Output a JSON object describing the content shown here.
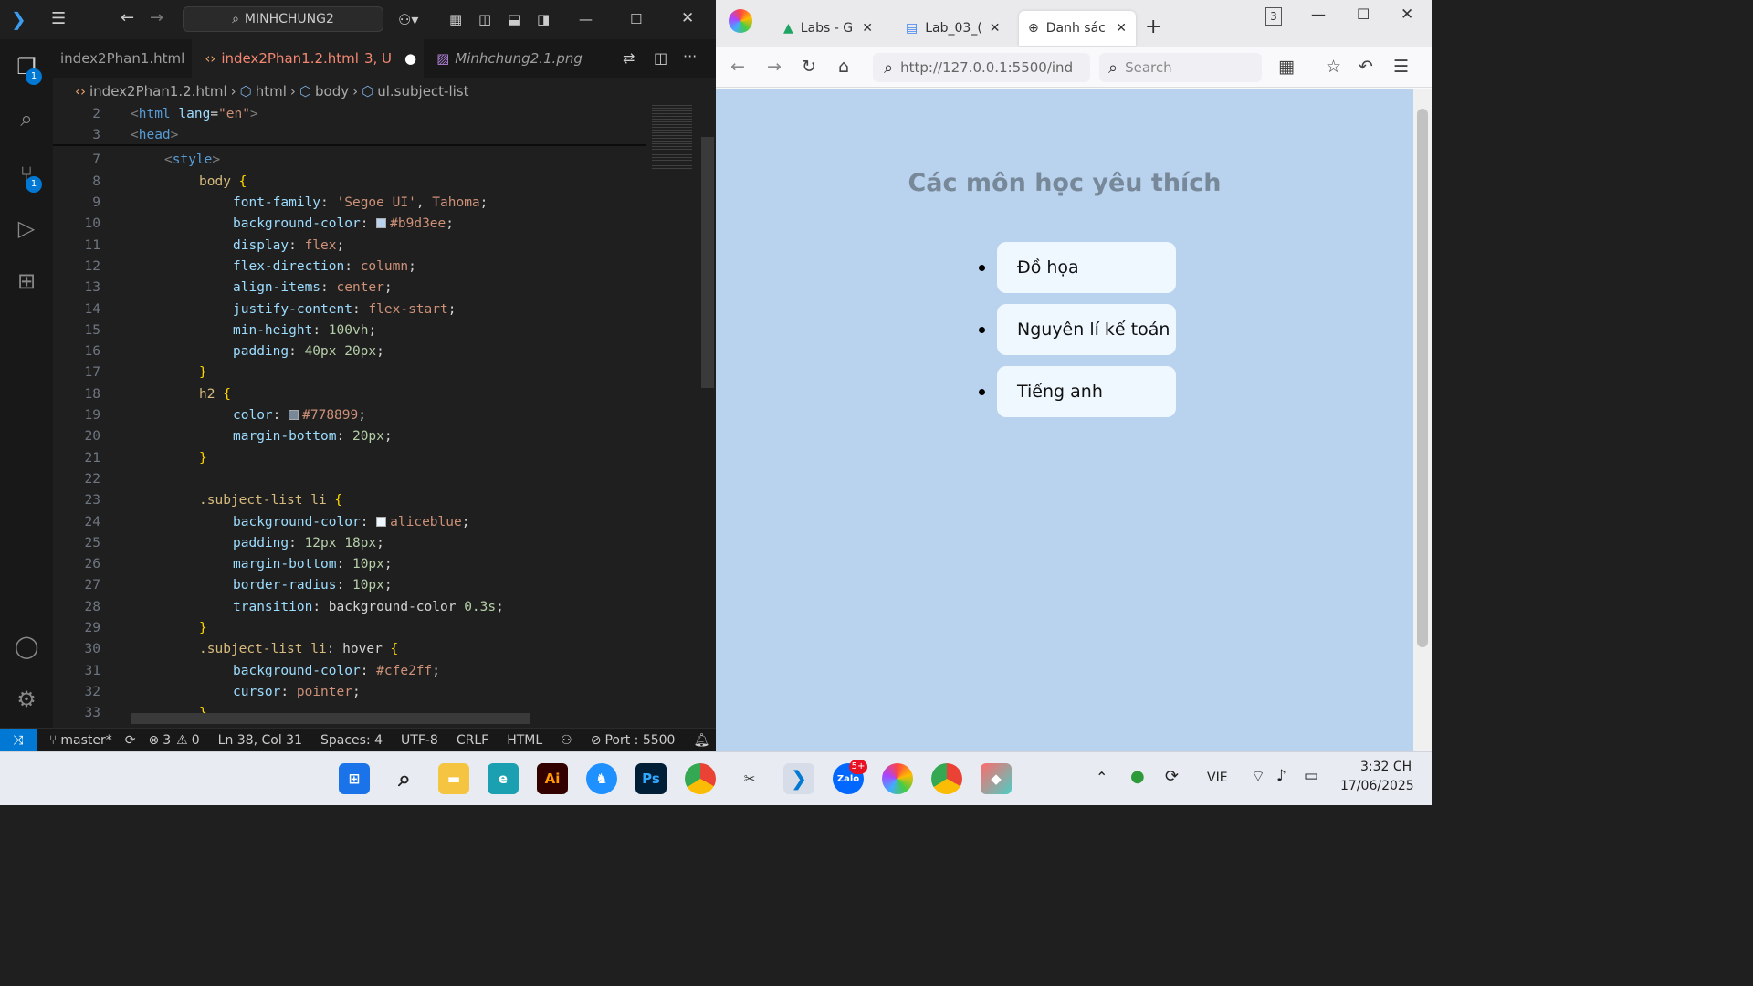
{
  "vscode": {
    "search": "MINHCHUNG2",
    "tabs": [
      {
        "label": "index2Phan1.html"
      },
      {
        "label": "index2Phan1.2.html",
        "status": "3, U"
      },
      {
        "label": "Minhchung2.1.png"
      }
    ],
    "breadcrumb": [
      "index2Phan1.2.html",
      "html",
      "body",
      "ul.subject-list"
    ],
    "explorer_badge": "1",
    "scm_badge": "1",
    "status": {
      "branch": "master*",
      "errors": "3",
      "warnings": "0",
      "position": "Ln 38, Col 31",
      "spaces": "Spaces: 4",
      "encoding": "UTF-8",
      "eol": "CRLF",
      "language": "HTML",
      "port": "Port : 5500"
    }
  },
  "browser": {
    "tabs": [
      {
        "label": "Labs - G"
      },
      {
        "label": "Lab_03_("
      },
      {
        "label": "Danh sác"
      }
    ],
    "url": "http://127.0.0.1:5500/ind",
    "search_placeholder": "Search",
    "tab_count": "3",
    "page": {
      "heading": "Các môn học yêu thích",
      "subjects": [
        "Đồ họa",
        "Nguyên lí kế toán",
        "Tiếng anh"
      ]
    }
  },
  "taskbar": {
    "zalo_badge": "5+",
    "lang": "VIE",
    "time": "3:32 CH",
    "date": "17/06/2025"
  },
  "colors": {
    "body_bg": "#b9d3ee",
    "heading": "#778899",
    "item_bg": "#f0f8ff",
    "accent": "#0078d4"
  }
}
